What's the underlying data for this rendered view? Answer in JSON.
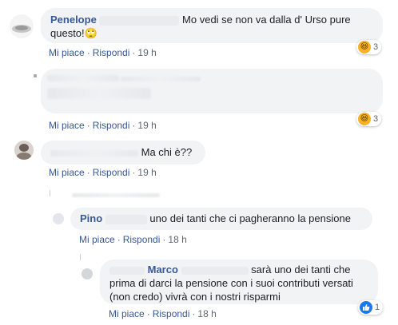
{
  "comments": [
    {
      "author": "Penelope",
      "text_line1": "Mo vedi se non va dalla d' Urso pure",
      "text_line2": "questo!",
      "emoji": "🙄",
      "actions": {
        "like": "Mi piace",
        "reply": "Rispondi",
        "time": "19 h"
      },
      "reaction": {
        "icon": "haha-icon",
        "count": "3"
      }
    },
    {
      "author": "",
      "text": "",
      "actions": {
        "like": "Mi piace",
        "reply": "Rispondi",
        "time": "19 h"
      },
      "reaction": {
        "icon": "haha-icon",
        "count": "3"
      }
    },
    {
      "author": "",
      "text": "Ma chi è??",
      "actions": {
        "like": "Mi piace",
        "reply": "Rispondi",
        "time": "19 h"
      }
    }
  ],
  "replies": [
    {
      "author": "Pino",
      "text": "uno dei tanti che ci pagheranno la pensione",
      "actions": {
        "like": "Mi piace",
        "reply": "Rispondi",
        "time": "18 h"
      }
    },
    {
      "author": "Marco",
      "text_line1": "sarà uno dei tanti che",
      "text_line2": "prima di darci la pensione con i suoi contributi versati",
      "text_line3": "(non credo) vivrà con i nostri risparmi",
      "actions": {
        "like": "Mi piace",
        "reply": "Rispondi",
        "time": "18 h"
      },
      "reaction": {
        "icon": "like-icon",
        "count": "1"
      }
    }
  ],
  "colors": {
    "link": "#385898",
    "bubble": "#f2f3f5",
    "meta": "#616770"
  }
}
